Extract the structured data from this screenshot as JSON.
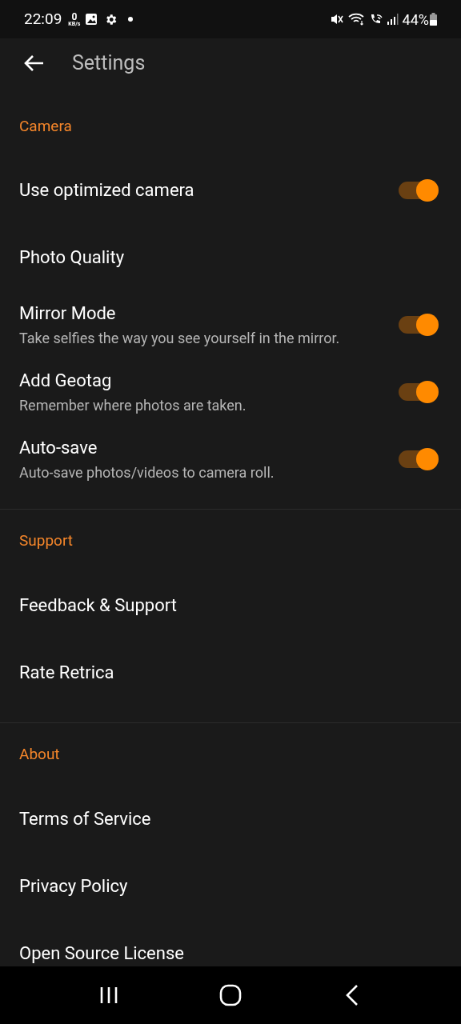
{
  "status_bar": {
    "time": "22:09",
    "speed_value": "0",
    "speed_unit": "KB/s",
    "battery": "44%"
  },
  "app_bar": {
    "title": "Settings"
  },
  "sections": [
    {
      "header": "Camera",
      "items": [
        {
          "kind": "toggle",
          "title": "Use optimized camera",
          "on": true
        },
        {
          "kind": "plain",
          "title": "Photo Quality"
        },
        {
          "kind": "toggle",
          "title": "Mirror Mode",
          "subtitle": "Take selfies the way you see yourself in the mirror.",
          "on": true
        },
        {
          "kind": "toggle",
          "title": "Add Geotag",
          "subtitle": "Remember where photos are taken.",
          "on": true
        },
        {
          "kind": "toggle",
          "title": "Auto-save",
          "subtitle": "Auto-save photos/videos to camera roll.",
          "on": true
        }
      ]
    },
    {
      "header": "Support",
      "items": [
        {
          "kind": "plain",
          "title": "Feedback & Support"
        },
        {
          "kind": "plain",
          "title": "Rate Retrica"
        }
      ]
    },
    {
      "header": "About",
      "items": [
        {
          "kind": "plain",
          "title": "Terms of Service"
        },
        {
          "kind": "plain",
          "title": "Privacy Policy"
        },
        {
          "kind": "plain",
          "title": "Open Source License"
        }
      ]
    }
  ]
}
